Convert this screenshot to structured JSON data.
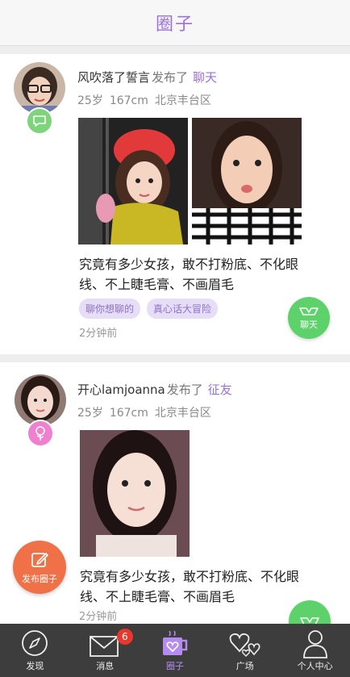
{
  "header": {
    "title": "圈子"
  },
  "posts": [
    {
      "username": "风吹落了誓言",
      "verb": "发布了",
      "topic": "聊天",
      "age": "25岁",
      "height": "167cm",
      "location": "北京丰台区",
      "badge_icon": "chat-bubble-icon",
      "content": "究竟有多少女孩，敢不打粉底、不化眼线、不上睫毛膏、不画眉毛",
      "tags": [
        "聊你想聊的",
        "真心话大冒险"
      ],
      "time": "2分钟前",
      "action_label": "聊天"
    },
    {
      "username": "开心lamjoanna",
      "verb": "发布了",
      "topic": "征友",
      "age": "25岁",
      "height": "167cm",
      "location": "北京丰台区",
      "badge_icon": "rose-icon",
      "content": "究竟有多少女孩，敢不打粉底、不化眼线、不上睫毛膏、不画眉毛",
      "time": "2分钟前"
    }
  ],
  "publish_button": {
    "label": "发布圈子"
  },
  "tabbar": {
    "items": [
      {
        "label": "发现",
        "icon": "compass-icon"
      },
      {
        "label": "消息",
        "icon": "envelope-icon",
        "badge": "6"
      },
      {
        "label": "圈子",
        "icon": "mug-heart-icon"
      },
      {
        "label": "广场",
        "icon": "hearts-icon"
      },
      {
        "label": "个人中心",
        "icon": "person-icon"
      }
    ]
  },
  "colors": {
    "accent": "#9b72d8",
    "chat_green": "#5dd26a",
    "publish_orange": "#f07148",
    "tabbar_bg": "#3d3d3d",
    "badge_red": "#e8372c"
  }
}
